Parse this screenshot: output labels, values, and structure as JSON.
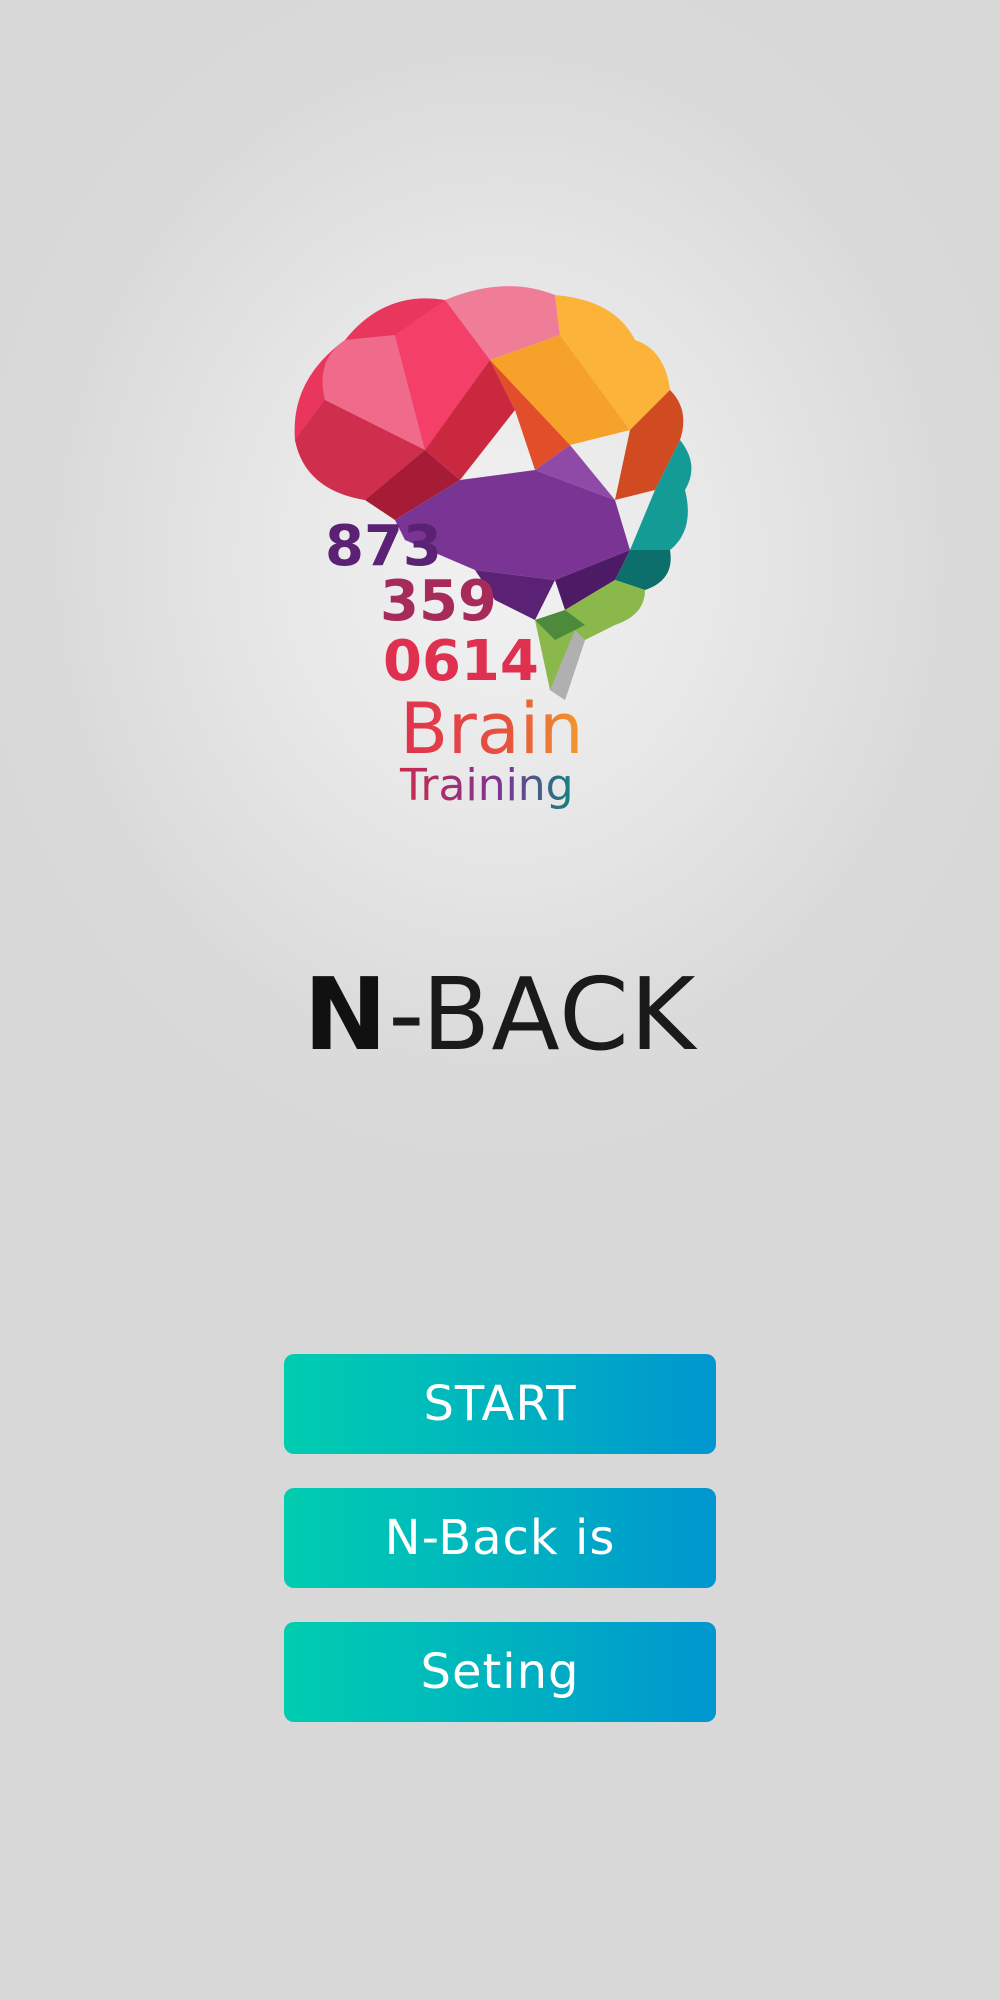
{
  "logo": {
    "digits_line1": "873",
    "digits_line2": "359",
    "digits_line3": "0614",
    "word1": "Brain",
    "word2": "Training"
  },
  "title": {
    "prefix": "N",
    "suffix": "-BACK"
  },
  "menu": {
    "start_label": "START",
    "about_label": "N-Back is",
    "setting_label": "Seting"
  },
  "colors": {
    "button_gradient_start": "#00cdb0",
    "button_gradient_end": "#0096d0",
    "button_text": "#ffffff",
    "title_text": "#111111"
  }
}
